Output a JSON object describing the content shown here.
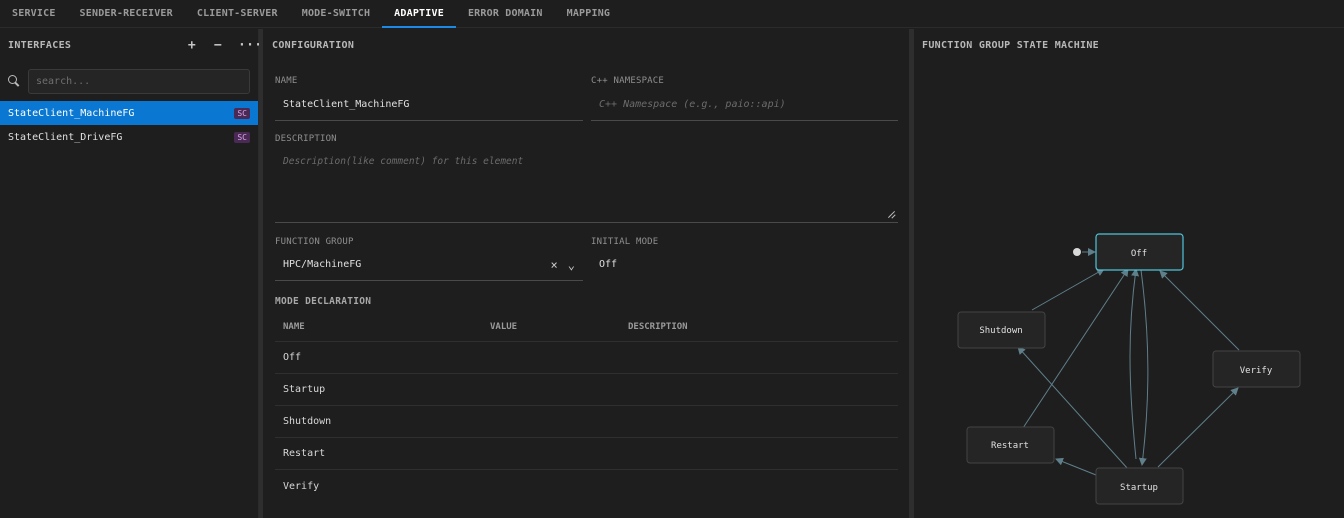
{
  "tabs": [
    {
      "label": "SERVICE",
      "active": false
    },
    {
      "label": "SENDER-RECEIVER",
      "active": false
    },
    {
      "label": "CLIENT-SERVER",
      "active": false
    },
    {
      "label": "MODE-SWITCH",
      "active": false
    },
    {
      "label": "ADAPTIVE",
      "active": true
    },
    {
      "label": "ERROR DOMAIN",
      "active": false
    },
    {
      "label": "MAPPING",
      "active": false
    }
  ],
  "interfaces": {
    "title": "INTERFACES",
    "add_label": "+",
    "remove_label": "−",
    "more_label": "···",
    "search": {
      "placeholder": "search...",
      "value": ""
    },
    "items": [
      {
        "label": "StateClient_MachineFG",
        "badge": "SC",
        "selected": true
      },
      {
        "label": "StateClient_DriveFG",
        "badge": "SC",
        "selected": false
      }
    ]
  },
  "configuration": {
    "title": "CONFIGURATION",
    "name": {
      "label": "NAME",
      "value": "StateClient_MachineFG"
    },
    "namespace": {
      "label": "C++ NAMESPACE",
      "value": "",
      "placeholder": "C++ Namespace (e.g., paio::api)"
    },
    "description": {
      "label": "DESCRIPTION",
      "value": "",
      "placeholder": "Description(like comment) for this element"
    },
    "function_group": {
      "label": "FUNCTION GROUP",
      "value": "HPC/MachineFG",
      "clear_label": "×",
      "dropdown_label": "⌄"
    },
    "initial_mode": {
      "label": "INITIAL MODE",
      "value": "Off"
    },
    "mode_declaration": {
      "title": "MODE DECLARATION",
      "columns": [
        "NAME",
        "VALUE",
        "DESCRIPTION"
      ],
      "rows": [
        {
          "name": "Off",
          "value": "",
          "description": ""
        },
        {
          "name": "Startup",
          "value": "",
          "description": ""
        },
        {
          "name": "Shutdown",
          "value": "",
          "description": ""
        },
        {
          "name": "Restart",
          "value": "",
          "description": ""
        },
        {
          "name": "Verify",
          "value": "",
          "description": ""
        }
      ]
    }
  },
  "state_machine": {
    "title": "FUNCTION GROUP STATE MACHINE",
    "nodes": [
      {
        "id": "off",
        "label": "Off",
        "initial": true
      },
      {
        "id": "shutdown",
        "label": "Shutdown"
      },
      {
        "id": "verify",
        "label": "Verify"
      },
      {
        "id": "restart",
        "label": "Restart"
      },
      {
        "id": "startup",
        "label": "Startup"
      }
    ],
    "colors": {
      "node_fill": "#252526",
      "node_stroke": "#444444",
      "initial_stroke": "#4fc3d9",
      "edge": "#5f7f8a"
    }
  }
}
